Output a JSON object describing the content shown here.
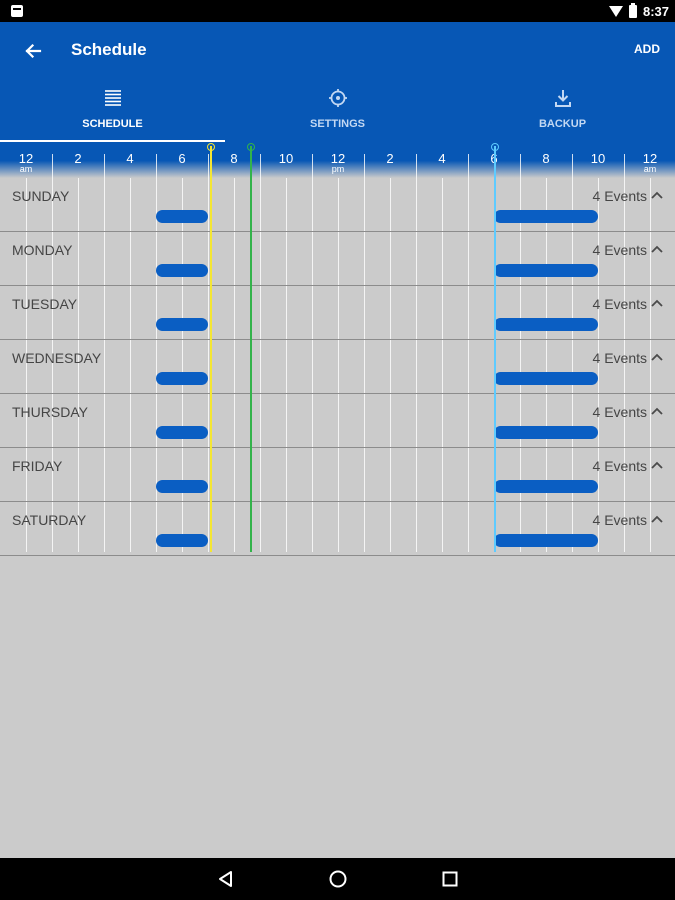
{
  "status_bar": {
    "time": "8:37",
    "icons": [
      "notification-icon",
      "wifi-icon",
      "battery-icon"
    ]
  },
  "app_bar": {
    "title": "Schedule",
    "back_icon": "arrow-left-icon",
    "add_label": "ADD",
    "color": "#0757b5"
  },
  "tabs": [
    {
      "label": "SCHEDULE",
      "icon": "list-icon",
      "active": true
    },
    {
      "label": "SETTINGS",
      "icon": "target-icon",
      "active": false
    },
    {
      "label": "BACKUP",
      "icon": "download-icon",
      "active": false
    }
  ],
  "timeline": {
    "ticks": [
      {
        "label": "12",
        "sub": "am"
      },
      {
        "label": "2",
        "sub": ""
      },
      {
        "label": "4",
        "sub": ""
      },
      {
        "label": "6",
        "sub": ""
      },
      {
        "label": "8",
        "sub": ""
      },
      {
        "label": "10",
        "sub": ""
      },
      {
        "label": "12",
        "sub": "pm"
      },
      {
        "label": "2",
        "sub": ""
      },
      {
        "label": "4",
        "sub": ""
      },
      {
        "label": "6",
        "sub": ""
      },
      {
        "label": "8",
        "sub": ""
      },
      {
        "label": "10",
        "sub": ""
      },
      {
        "label": "12",
        "sub": "am"
      }
    ],
    "markers": [
      {
        "name": "sunrise-marker",
        "hour": 7.1,
        "color": "#f4e633"
      },
      {
        "name": "current-time-marker",
        "hour": 8.65,
        "color": "#32b34a"
      },
      {
        "name": "sunset-marker",
        "hour": 18.05,
        "color": "#5ecbff"
      }
    ]
  },
  "days": [
    {
      "name": "SUNDAY",
      "events": "4 Events",
      "bars": [
        [
          5,
          7
        ],
        [
          18,
          22
        ]
      ]
    },
    {
      "name": "MONDAY",
      "events": "4 Events",
      "bars": [
        [
          5,
          7
        ],
        [
          18,
          22
        ]
      ]
    },
    {
      "name": "TUESDAY",
      "events": "4 Events",
      "bars": [
        [
          5,
          7
        ],
        [
          18,
          22
        ]
      ]
    },
    {
      "name": "WEDNESDAY",
      "events": "4 Events",
      "bars": [
        [
          5,
          7
        ],
        [
          18,
          22
        ]
      ]
    },
    {
      "name": "THURSDAY",
      "events": "4 Events",
      "bars": [
        [
          5,
          7
        ],
        [
          18,
          22
        ]
      ]
    },
    {
      "name": "FRIDAY",
      "events": "4 Events",
      "bars": [
        [
          5,
          7
        ],
        [
          18,
          22
        ]
      ]
    },
    {
      "name": "SATURDAY",
      "events": "4 Events",
      "bars": [
        [
          5,
          7
        ],
        [
          18,
          22
        ]
      ]
    }
  ],
  "nav_bar": {
    "buttons": [
      "back-triangle-icon",
      "home-circle-icon",
      "recents-square-icon"
    ]
  }
}
